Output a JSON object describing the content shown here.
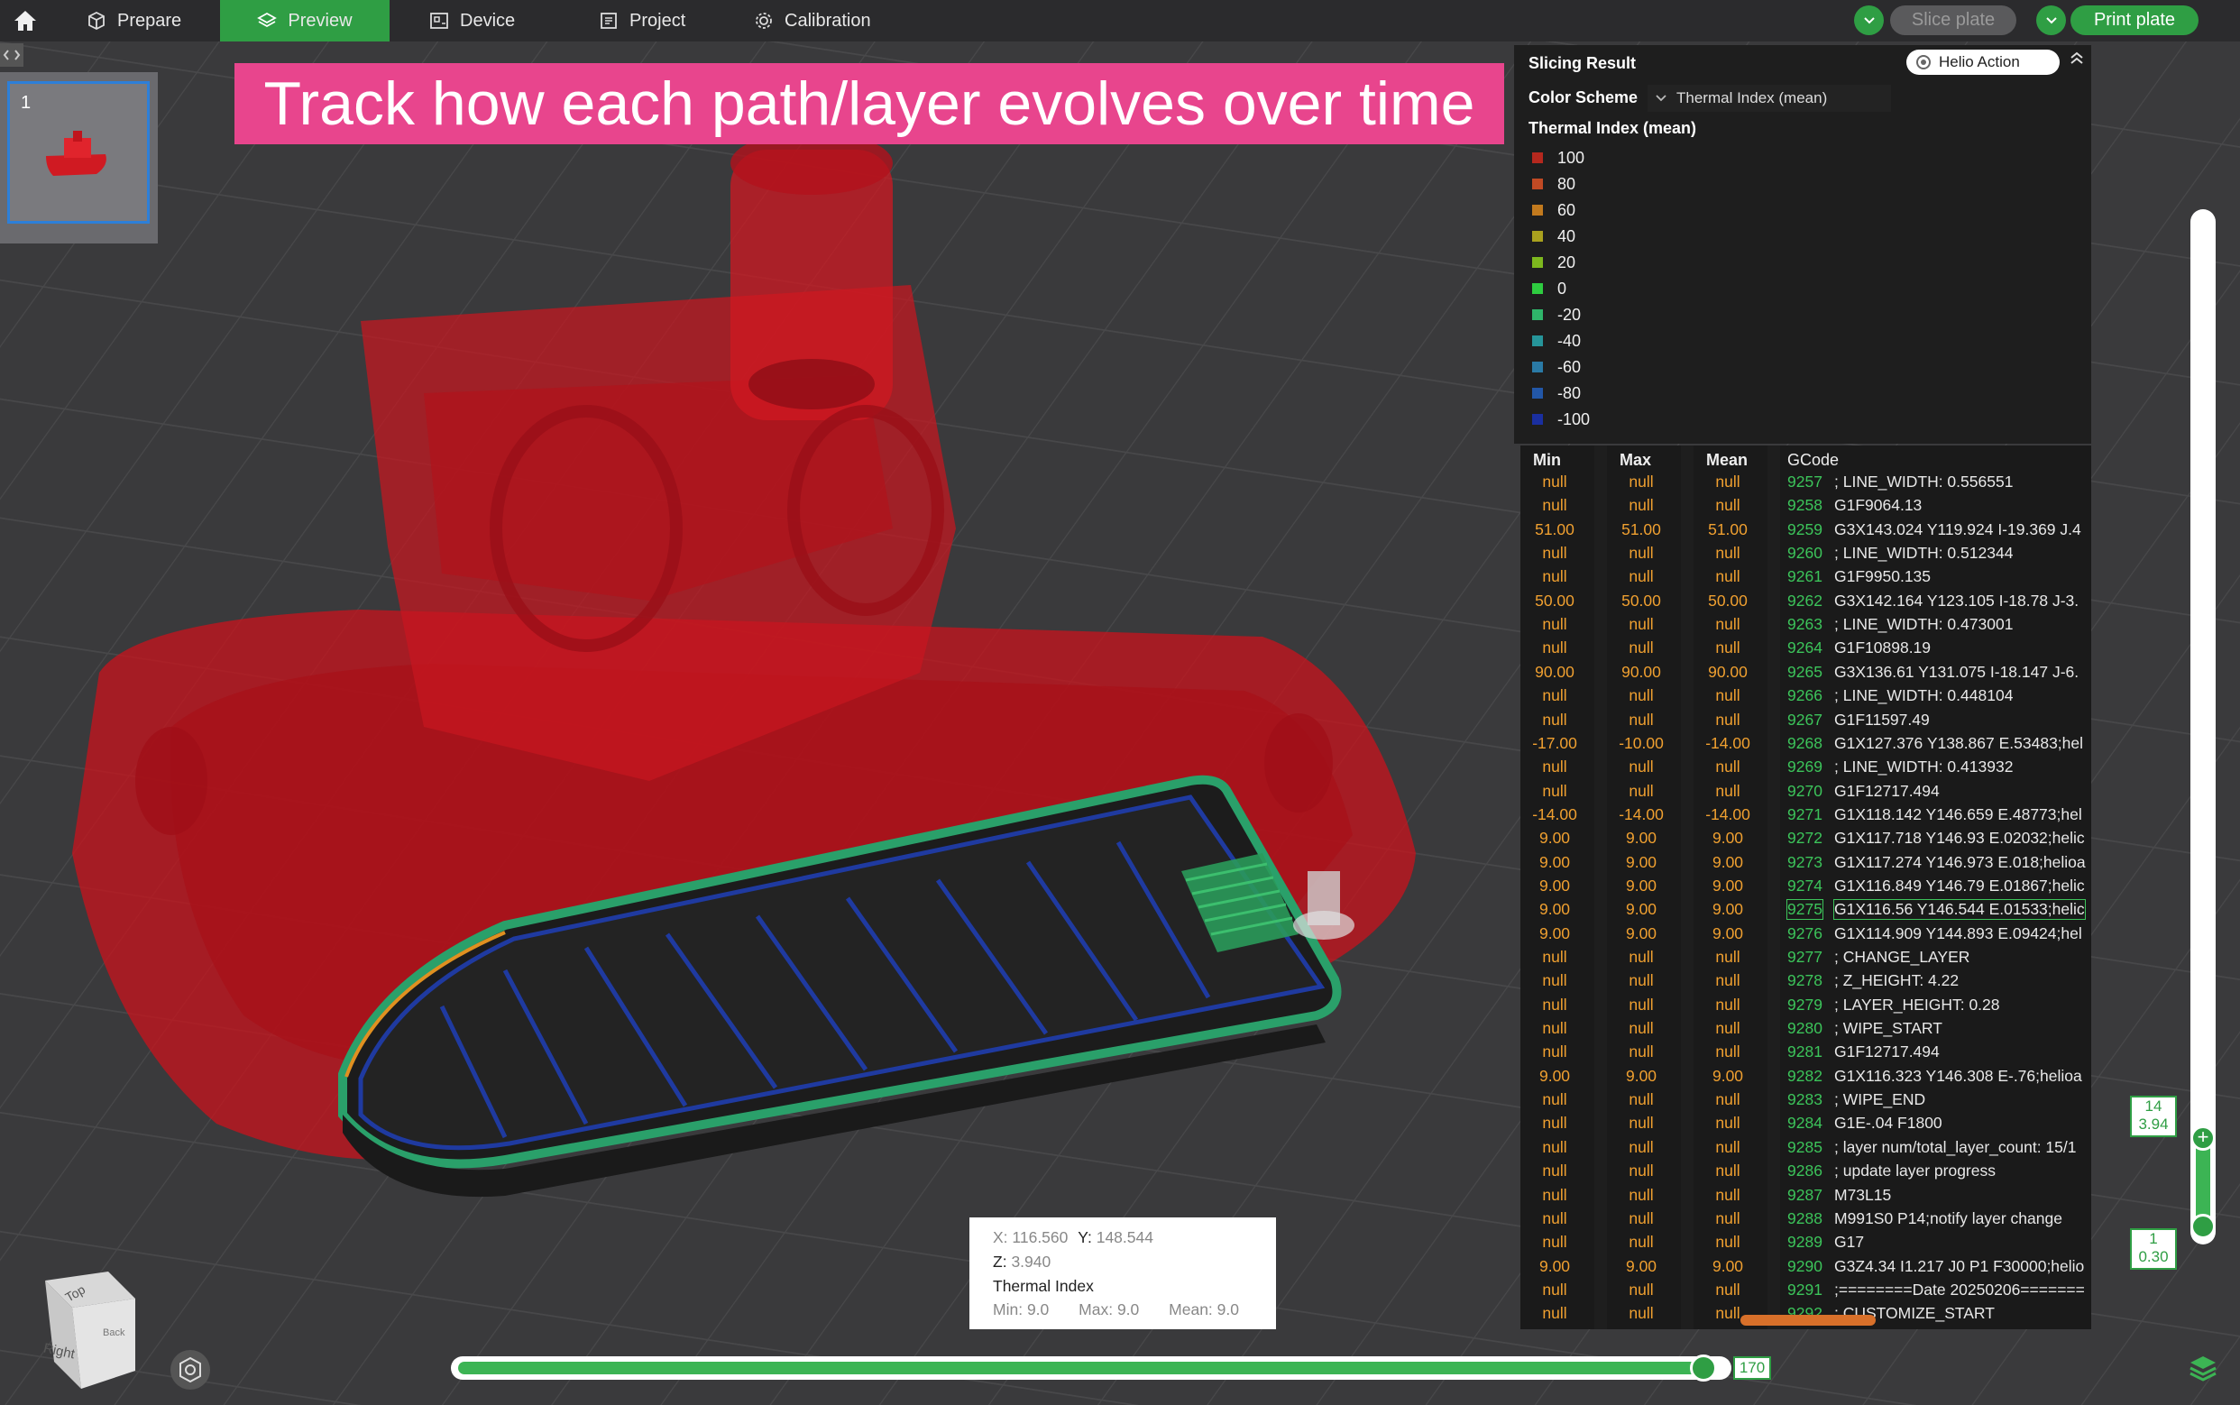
{
  "topbar": {
    "tabs": [
      {
        "label": "Prepare"
      },
      {
        "label": "Preview"
      },
      {
        "label": "Device"
      },
      {
        "label": "Project"
      },
      {
        "label": "Calibration"
      }
    ],
    "slice_button": "Slice plate",
    "print_button": "Print plate"
  },
  "banner": "Track how each path/layer evolves over time",
  "plate": {
    "number": "1"
  },
  "slicing_result": {
    "title": "Slicing Result",
    "helio_action": "Helio Action",
    "color_scheme_label": "Color Scheme",
    "color_scheme_value": "Thermal Index (mean)",
    "legend_title": "Thermal Index (mean)",
    "legend": [
      {
        "label": "100",
        "color": "#b5281e"
      },
      {
        "label": "80",
        "color": "#c14a24"
      },
      {
        "label": "60",
        "color": "#c27a1e"
      },
      {
        "label": "40",
        "color": "#a9a11e"
      },
      {
        "label": "20",
        "color": "#7db81e"
      },
      {
        "label": "0",
        "color": "#2ecc40"
      },
      {
        "label": "-20",
        "color": "#2fb56a"
      },
      {
        "label": "-40",
        "color": "#26959a"
      },
      {
        "label": "-60",
        "color": "#2a7aa6"
      },
      {
        "label": "-80",
        "color": "#2257a8"
      },
      {
        "label": "-100",
        "color": "#1a2fa0"
      }
    ]
  },
  "gcode_table": {
    "headers": {
      "min": "Min",
      "max": "Max",
      "mean": "Mean",
      "gcode": "GCode"
    },
    "rows": [
      {
        "min": "null",
        "max": "null",
        "mean": "null",
        "ln": "9257",
        "code": "; LINE_WIDTH: 0.556551"
      },
      {
        "min": "null",
        "max": "null",
        "mean": "null",
        "ln": "9258",
        "code": "G1F9064.13"
      },
      {
        "min": "51.00",
        "max": "51.00",
        "mean": "51.00",
        "ln": "9259",
        "code": "G3X143.024 Y119.924 I-19.369 J.4"
      },
      {
        "min": "null",
        "max": "null",
        "mean": "null",
        "ln": "9260",
        "code": "; LINE_WIDTH: 0.512344"
      },
      {
        "min": "null",
        "max": "null",
        "mean": "null",
        "ln": "9261",
        "code": "G1F9950.135"
      },
      {
        "min": "50.00",
        "max": "50.00",
        "mean": "50.00",
        "ln": "9262",
        "code": "G3X142.164 Y123.105 I-18.78 J-3."
      },
      {
        "min": "null",
        "max": "null",
        "mean": "null",
        "ln": "9263",
        "code": "; LINE_WIDTH: 0.473001"
      },
      {
        "min": "null",
        "max": "null",
        "mean": "null",
        "ln": "9264",
        "code": "G1F10898.19"
      },
      {
        "min": "90.00",
        "max": "90.00",
        "mean": "90.00",
        "ln": "9265",
        "code": "G3X136.61 Y131.075 I-18.147 J-6."
      },
      {
        "min": "null",
        "max": "null",
        "mean": "null",
        "ln": "9266",
        "code": "; LINE_WIDTH: 0.448104"
      },
      {
        "min": "null",
        "max": "null",
        "mean": "null",
        "ln": "9267",
        "code": "G1F11597.49"
      },
      {
        "min": "-17.00",
        "max": "-10.00",
        "mean": "-14.00",
        "ln": "9268",
        "code": "G1X127.376 Y138.867 E.53483;hel"
      },
      {
        "min": "null",
        "max": "null",
        "mean": "null",
        "ln": "9269",
        "code": "; LINE_WIDTH: 0.413932"
      },
      {
        "min": "null",
        "max": "null",
        "mean": "null",
        "ln": "9270",
        "code": "G1F12717.494"
      },
      {
        "min": "-14.00",
        "max": "-14.00",
        "mean": "-14.00",
        "ln": "9271",
        "code": "G1X118.142 Y146.659 E.48773;hel"
      },
      {
        "min": "9.00",
        "max": "9.00",
        "mean": "9.00",
        "ln": "9272",
        "code": "G1X117.718 Y146.93 E.02032;helic"
      },
      {
        "min": "9.00",
        "max": "9.00",
        "mean": "9.00",
        "ln": "9273",
        "code": "G1X117.274 Y146.973 E.018;helioa"
      },
      {
        "min": "9.00",
        "max": "9.00",
        "mean": "9.00",
        "ln": "9274",
        "code": "G1X116.849 Y146.79 E.01867;helic"
      },
      {
        "min": "9.00",
        "max": "9.00",
        "mean": "9.00",
        "ln": "9275",
        "code": "G1X116.56 Y146.544 E.01533;helic"
      },
      {
        "min": "9.00",
        "max": "9.00",
        "mean": "9.00",
        "ln": "9276",
        "code": "G1X114.909 Y144.893 E.09424;hel"
      },
      {
        "min": "null",
        "max": "null",
        "mean": "null",
        "ln": "9277",
        "code": "; CHANGE_LAYER"
      },
      {
        "min": "null",
        "max": "null",
        "mean": "null",
        "ln": "9278",
        "code": "; Z_HEIGHT: 4.22"
      },
      {
        "min": "null",
        "max": "null",
        "mean": "null",
        "ln": "9279",
        "code": "; LAYER_HEIGHT: 0.28"
      },
      {
        "min": "null",
        "max": "null",
        "mean": "null",
        "ln": "9280",
        "code": "; WIPE_START"
      },
      {
        "min": "null",
        "max": "null",
        "mean": "null",
        "ln": "9281",
        "code": "G1F12717.494"
      },
      {
        "min": "9.00",
        "max": "9.00",
        "mean": "9.00",
        "ln": "9282",
        "code": "G1X116.323 Y146.308 E-.76;helioa"
      },
      {
        "min": "null",
        "max": "null",
        "mean": "null",
        "ln": "9283",
        "code": "; WIPE_END"
      },
      {
        "min": "null",
        "max": "null",
        "mean": "null",
        "ln": "9284",
        "code": "G1E-.04 F1800"
      },
      {
        "min": "null",
        "max": "null",
        "mean": "null",
        "ln": "9285",
        "code": "; layer num/total_layer_count: 15/1"
      },
      {
        "min": "null",
        "max": "null",
        "mean": "null",
        "ln": "9286",
        "code": "; update layer progress"
      },
      {
        "min": "null",
        "max": "null",
        "mean": "null",
        "ln": "9287",
        "code": "M73L15"
      },
      {
        "min": "null",
        "max": "null",
        "mean": "null",
        "ln": "9288",
        "code": "M991S0 P14;notify layer change"
      },
      {
        "min": "null",
        "max": "null",
        "mean": "null",
        "ln": "9289",
        "code": "G17"
      },
      {
        "min": "9.00",
        "max": "9.00",
        "mean": "9.00",
        "ln": "9290",
        "code": "G3Z4.34 I1.217 J0 P1 F30000;helio"
      },
      {
        "min": "null",
        "max": "null",
        "mean": "null",
        "ln": "9291",
        "code": ";========Date 20250206======="
      },
      {
        "min": "null",
        "max": "null",
        "mean": "null",
        "ln": "9292",
        "code": "; CUSTOMIZE_START"
      }
    ],
    "selected_line": "9275"
  },
  "tooltip": {
    "x_label": "X:",
    "x_value": "116.560",
    "y_label": "Y:",
    "y_value": "148.544",
    "z_label": "Z:",
    "z_value": "3.940",
    "metric": "Thermal Index",
    "min_label": "Min:",
    "min_value": "9.0",
    "max_label": "Max:",
    "max_value": "9.0",
    "mean_label": "Mean:",
    "mean_value": "9.0"
  },
  "horizontal_slider": {
    "value": "170",
    "fraction": 0.99
  },
  "vertical_slider": {
    "top_layer": "14",
    "top_height": "3.94",
    "bottom_layer": "1",
    "bottom_height": "0.30"
  },
  "view_cube": {
    "top": "Top",
    "right": "Right",
    "back": "Back"
  },
  "colors": {
    "accent": "#2f9e44",
    "banner": "#e8458d",
    "model": "#c4141e"
  }
}
